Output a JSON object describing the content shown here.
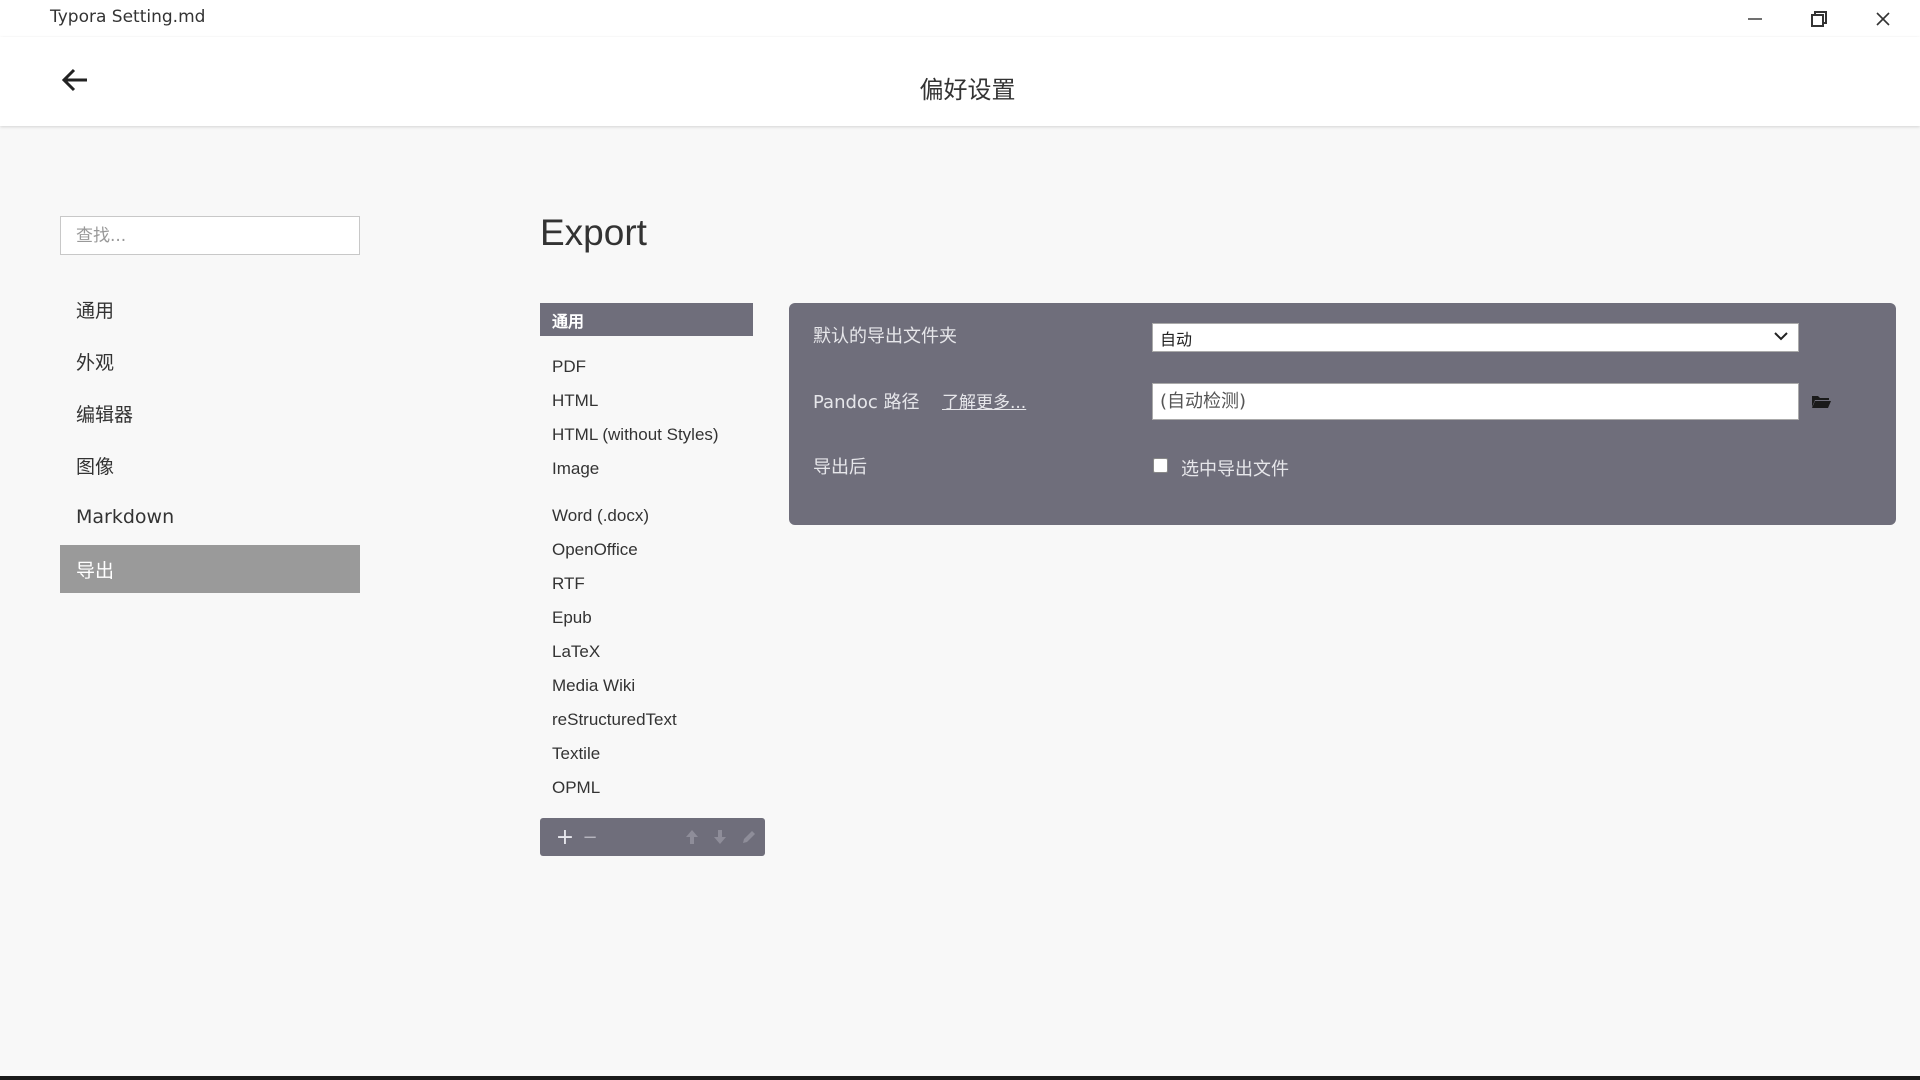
{
  "window": {
    "title": "Typora Setting.md",
    "minimize_icon": "minimize-icon",
    "maximize_icon": "restore-icon",
    "close_icon": "close-icon"
  },
  "header": {
    "title": "偏好设置",
    "back_icon": "arrow-left-icon"
  },
  "sidebar": {
    "search_placeholder": "查找...",
    "items": [
      {
        "label": "通用"
      },
      {
        "label": "外观"
      },
      {
        "label": "编辑器"
      },
      {
        "label": "图像"
      },
      {
        "label": "Markdown"
      },
      {
        "label": "导出",
        "active": true
      }
    ]
  },
  "main": {
    "section_title": "Export",
    "format_list": {
      "selected": "通用",
      "items": [
        "PDF",
        "HTML",
        "HTML (without Styles)",
        "Image",
        "Word (.docx)",
        "OpenOffice",
        "RTF",
        "Epub",
        "LaTeX",
        "Media Wiki",
        "reStructuredText",
        "Textile",
        "OPML"
      ],
      "toolbar": {
        "add": "+",
        "remove": "−",
        "move_up_icon": "arrow-up-icon",
        "move_down_icon": "arrow-down-icon",
        "edit_icon": "pencil-icon"
      }
    },
    "settings": {
      "export_folder_label": "默认的导出文件夹",
      "export_folder_value": "自动",
      "pandoc_label": "Pandoc 路径",
      "learn_more": "了解更多...",
      "pandoc_placeholder": "(自动检测)",
      "folder_icon": "folder-icon",
      "after_export_label": "导出后",
      "select_file_label": "选中导出文件"
    }
  },
  "colors": {
    "panel_bg": "#6f6e7b",
    "active_nav_bg": "#9a9a9a",
    "page_bg": "#f8f8f8"
  }
}
